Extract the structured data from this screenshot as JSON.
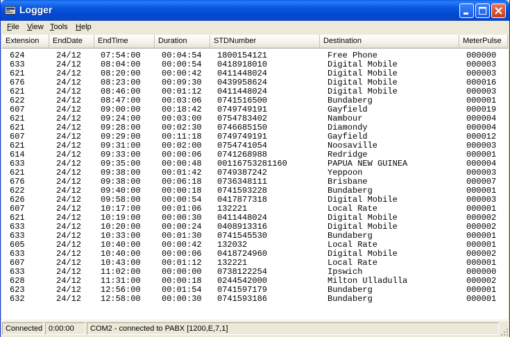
{
  "window": {
    "title": "Logger",
    "icon": "app-icon",
    "buttons": [
      "minimize-icon",
      "maximize-icon",
      "close-icon"
    ]
  },
  "menu": {
    "items": [
      {
        "label": "File",
        "underline": "F",
        "rest": "ile"
      },
      {
        "label": "View",
        "underline": "V",
        "rest": "iew"
      },
      {
        "label": "Tools",
        "underline": "T",
        "rest": "ools"
      },
      {
        "label": "Help",
        "underline": "H",
        "rest": "elp"
      }
    ]
  },
  "table": {
    "columns": [
      "Extension",
      "EndDate",
      "EndTime",
      "Duration",
      "STDNumber",
      "Destination",
      "MeterPulse"
    ],
    "rows": [
      [
        "624",
        "24/12",
        "07:54:00",
        "00:04:54",
        "1800154121",
        "Free Phone",
        "000000"
      ],
      [
        "633",
        "24/12",
        "08:04:00",
        "00:00:54",
        "0418918010",
        "Digital Mobile",
        "000003"
      ],
      [
        "621",
        "24/12",
        "08:20:00",
        "00:00:42",
        "0411448024",
        "Digital Mobile",
        "000003"
      ],
      [
        "676",
        "24/12",
        "08:23:00",
        "00:09:30",
        "0439958624",
        "Digital Mobile",
        "000016"
      ],
      [
        "621",
        "24/12",
        "08:46:00",
        "00:01:12",
        "0411448024",
        "Digital Mobile",
        "000003"
      ],
      [
        "622",
        "24/12",
        "08:47:00",
        "00:03:06",
        "0741516500",
        "Bundaberg",
        "000001"
      ],
      [
        "607",
        "24/12",
        "09:00:00",
        "00:18:42",
        "0749749191",
        "Gayfield",
        "000019"
      ],
      [
        "621",
        "24/12",
        "09:24:00",
        "00:03:00",
        "0754783402",
        "Nambour",
        "000004"
      ],
      [
        "621",
        "24/12",
        "09:28:00",
        "00:02:30",
        "0746685150",
        "Diamondy",
        "000004"
      ],
      [
        "607",
        "24/12",
        "09:29:00",
        "00:11:18",
        "0749749191",
        "Gayfield",
        "000012"
      ],
      [
        "621",
        "24/12",
        "09:31:00",
        "00:02:00",
        "0754741054",
        "Noosaville",
        "000003"
      ],
      [
        "614",
        "24/12",
        "09:33:00",
        "00:00:06",
        "0741268988",
        "Redridge",
        "000001"
      ],
      [
        "633",
        "24/12",
        "09:35:00",
        "00:00:48",
        "00116753281160",
        "PAPUA NEW GUINEA",
        "000004"
      ],
      [
        "621",
        "24/12",
        "09:38:00",
        "00:01:42",
        "0749387242",
        "Yeppoon",
        "000003"
      ],
      [
        "676",
        "24/12",
        "09:38:00",
        "00:06:18",
        "0736348111",
        "Brisbane",
        "000007"
      ],
      [
        "622",
        "24/12",
        "09:40:00",
        "00:00:18",
        "0741593228",
        "Bundaberg",
        "000001"
      ],
      [
        "626",
        "24/12",
        "09:58:00",
        "00:00:54",
        "0417877318",
        "Digital Mobile",
        "000003"
      ],
      [
        "607",
        "24/12",
        "10:17:00",
        "00:01:06",
        "132221",
        "Local Rate",
        "000001"
      ],
      [
        "621",
        "24/12",
        "10:19:00",
        "00:00:30",
        "0411448024",
        "Digital Mobile",
        "000002"
      ],
      [
        "633",
        "24/12",
        "10:20:00",
        "00:00:24",
        "0408913316",
        "Digital Mobile",
        "000002"
      ],
      [
        "633",
        "24/12",
        "10:33:00",
        "00:01:30",
        "0741545530",
        "Bundaberg",
        "000001"
      ],
      [
        "605",
        "24/12",
        "10:40:00",
        "00:00:42",
        "132032",
        "Local Rate",
        "000001"
      ],
      [
        "633",
        "24/12",
        "10:40:00",
        "00:00:06",
        "0418724960",
        "Digital Mobile",
        "000002"
      ],
      [
        "607",
        "24/12",
        "10:43:00",
        "00:01:12",
        "132221",
        "Local Rate",
        "000001"
      ],
      [
        "633",
        "24/12",
        "11:02:00",
        "00:00:00",
        "0738122254",
        "Ipswich",
        "000000"
      ],
      [
        "628",
        "24/12",
        "11:31:00",
        "00:00:18",
        "0244542000",
        "Milton Ulladulla",
        "000002"
      ],
      [
        "623",
        "24/12",
        "12:56:00",
        "00:01:54",
        "0741597179",
        "Bundaberg",
        "000001"
      ],
      [
        "632",
        "24/12",
        "12:58:00",
        "00:00:30",
        "0741593186",
        "Bundaberg",
        "000001"
      ]
    ]
  },
  "status": {
    "connection": "Connected",
    "timer": "0:00:00",
    "port_info": "COM2 - connected to PABX [1200,E,7,1]"
  }
}
